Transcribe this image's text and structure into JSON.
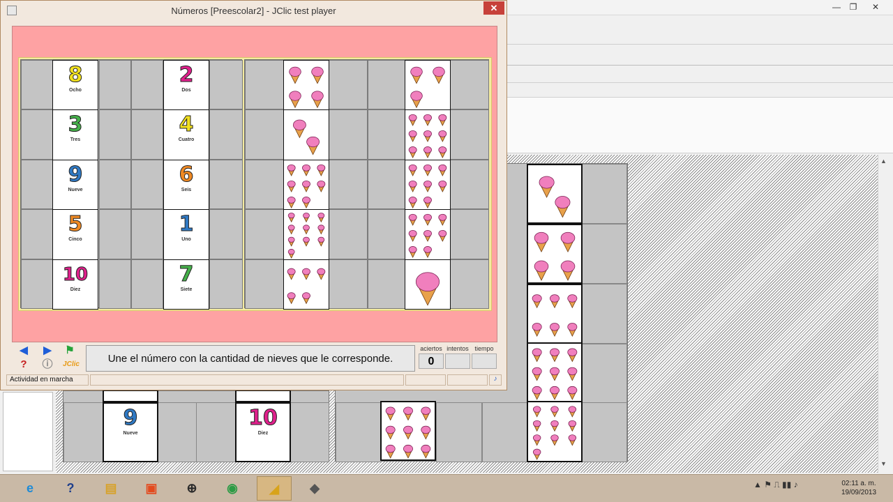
{
  "window": {
    "title": "Números [Preescolar2] - JClic test player",
    "close_symbol": "✕"
  },
  "background_window": {
    "minimize_symbol": "—",
    "restore_symbol": "❐",
    "close_symbol": "✕",
    "visible_cards": [
      {
        "number": "9",
        "word": "Nueve",
        "color": "#2f79c4"
      },
      {
        "number": "10",
        "word": "Diez",
        "color": "#e0208c"
      }
    ]
  },
  "activity": {
    "number_cards": [
      {
        "number": "8",
        "word": "Ocho",
        "color": "#f2e11f"
      },
      {
        "number": "2",
        "word": "Dos",
        "color": "#e0208c"
      },
      {
        "number": "3",
        "word": "Tres",
        "color": "#45b04a"
      },
      {
        "number": "4",
        "word": "Cuatro",
        "color": "#f2e11f"
      },
      {
        "number": "9",
        "word": "Nueve",
        "color": "#2f79c4"
      },
      {
        "number": "6",
        "word": "Seis",
        "color": "#f08a24"
      },
      {
        "number": "5",
        "word": "Cinco",
        "color": "#f08a24"
      },
      {
        "number": "1",
        "word": "Uno",
        "color": "#2f79c4"
      },
      {
        "number": "10",
        "word": "Diez",
        "color": "#e0208c"
      },
      {
        "number": "7",
        "word": "Siete",
        "color": "#45b04a"
      }
    ],
    "cone_card_counts": [
      4,
      3,
      2,
      9,
      8,
      8,
      10,
      8,
      5,
      1
    ],
    "instruction": "Une el número con la cantidad de nieves que le corresponde."
  },
  "counters": {
    "aciertos_label": "aciertos",
    "aciertos_value": "0",
    "intentos_label": "intentos",
    "intentos_value": "",
    "tiempo_label": "tiempo",
    "tiempo_value": ""
  },
  "controls": {
    "prev_icon": "arrow-left-icon",
    "next_icon": "arrow-right-icon",
    "reports_icon": "green-flag-icon",
    "help_icon": "question-icon",
    "info_icon": "info-icon",
    "logo_text": "JClic"
  },
  "status": {
    "text": "Actividad en marcha"
  },
  "taskbar": {
    "apps": [
      {
        "name": "internet-explorer",
        "glyph": "e",
        "color": "#1e8bd6"
      },
      {
        "name": "help",
        "glyph": "?",
        "color": "#1f3f8c"
      },
      {
        "name": "file-explorer",
        "glyph": "▤",
        "color": "#d7a22b"
      },
      {
        "name": "office",
        "glyph": "▣",
        "color": "#e34a1e"
      },
      {
        "name": "network",
        "glyph": "⊕",
        "color": "#2a2a2a"
      },
      {
        "name": "chrome",
        "glyph": "◉",
        "color": "#2c9b45"
      },
      {
        "name": "jclic",
        "glyph": "◢",
        "color": "#d8a31a"
      },
      {
        "name": "java",
        "glyph": "◆",
        "color": "#555555"
      }
    ],
    "tray_icons": "▲ ⚑ ⎍ ▮▮ ♪",
    "clock_time": "02:11 a. m.",
    "clock_date": "19/09/2013"
  }
}
